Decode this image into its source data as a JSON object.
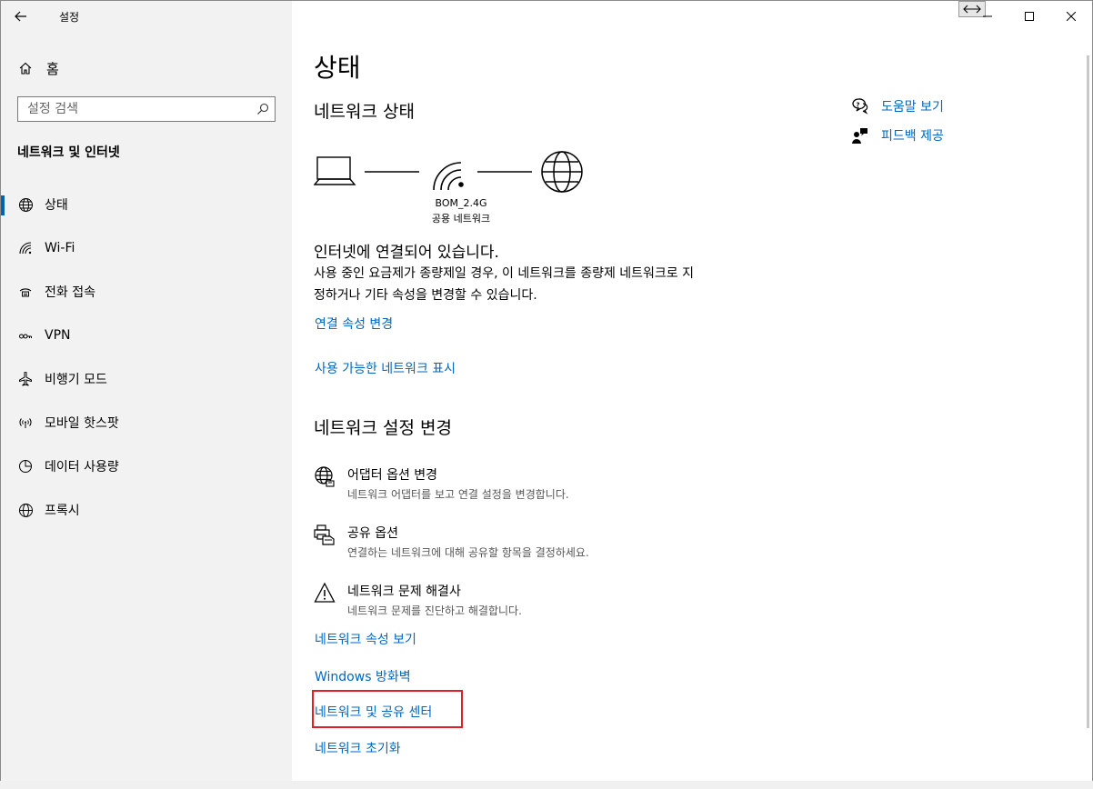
{
  "window": {
    "title": "설정"
  },
  "sidebar": {
    "home_label": "홈",
    "search_placeholder": "설정 검색",
    "section_title": "네트워크 및 인터넷",
    "items": [
      {
        "label": "상태",
        "icon": "globe-status-icon",
        "active": true
      },
      {
        "label": "Wi-Fi",
        "icon": "wifi-icon"
      },
      {
        "label": "전화 접속",
        "icon": "dialup-icon"
      },
      {
        "label": "VPN",
        "icon": "vpn-icon"
      },
      {
        "label": "비행기 모드",
        "icon": "airplane-icon"
      },
      {
        "label": "모바일 핫스팟",
        "icon": "hotspot-icon"
      },
      {
        "label": "데이터 사용량",
        "icon": "data-usage-icon"
      },
      {
        "label": "프록시",
        "icon": "globe-icon"
      }
    ]
  },
  "main": {
    "page_title": "상태",
    "network_status_heading": "네트워크 상태",
    "network_name": "BOM_2.4G",
    "network_type": "공용 네트워크",
    "status_main": "인터넷에 연결되어 있습니다.",
    "status_desc": "사용 중인 요금제가 종량제일 경우, 이 네트워크를 종량제 네트워크로 지정하거나 기타 속성을 변경할 수 있습니다.",
    "link_change_props": "연결 속성 변경",
    "link_show_networks": "사용 가능한 네트워크 표시",
    "change_settings_heading": "네트워크 설정 변경",
    "settings": [
      {
        "title": "어댑터 옵션 변경",
        "desc": "네트워크 어댑터를 보고 연결 설정을 변경합니다."
      },
      {
        "title": "공유 옵션",
        "desc": "연결하는 네트워크에 대해 공유할 항목을 결정하세요."
      },
      {
        "title": "네트워크 문제 해결사",
        "desc": "네트워크 문제를 진단하고 해결합니다."
      }
    ],
    "link_view_props": "네트워크 속성 보기",
    "link_firewall": "Windows 방화벽",
    "link_sharing_center": "네트워크 및 공유 센터",
    "link_reset": "네트워크 초기화"
  },
  "right": {
    "help_label": "도움말 보기",
    "feedback_label": "피드백 제공"
  },
  "colors": {
    "accent": "#0067c0",
    "highlight": "#e21e27",
    "sidebar_bg": "#f2f2f2"
  }
}
